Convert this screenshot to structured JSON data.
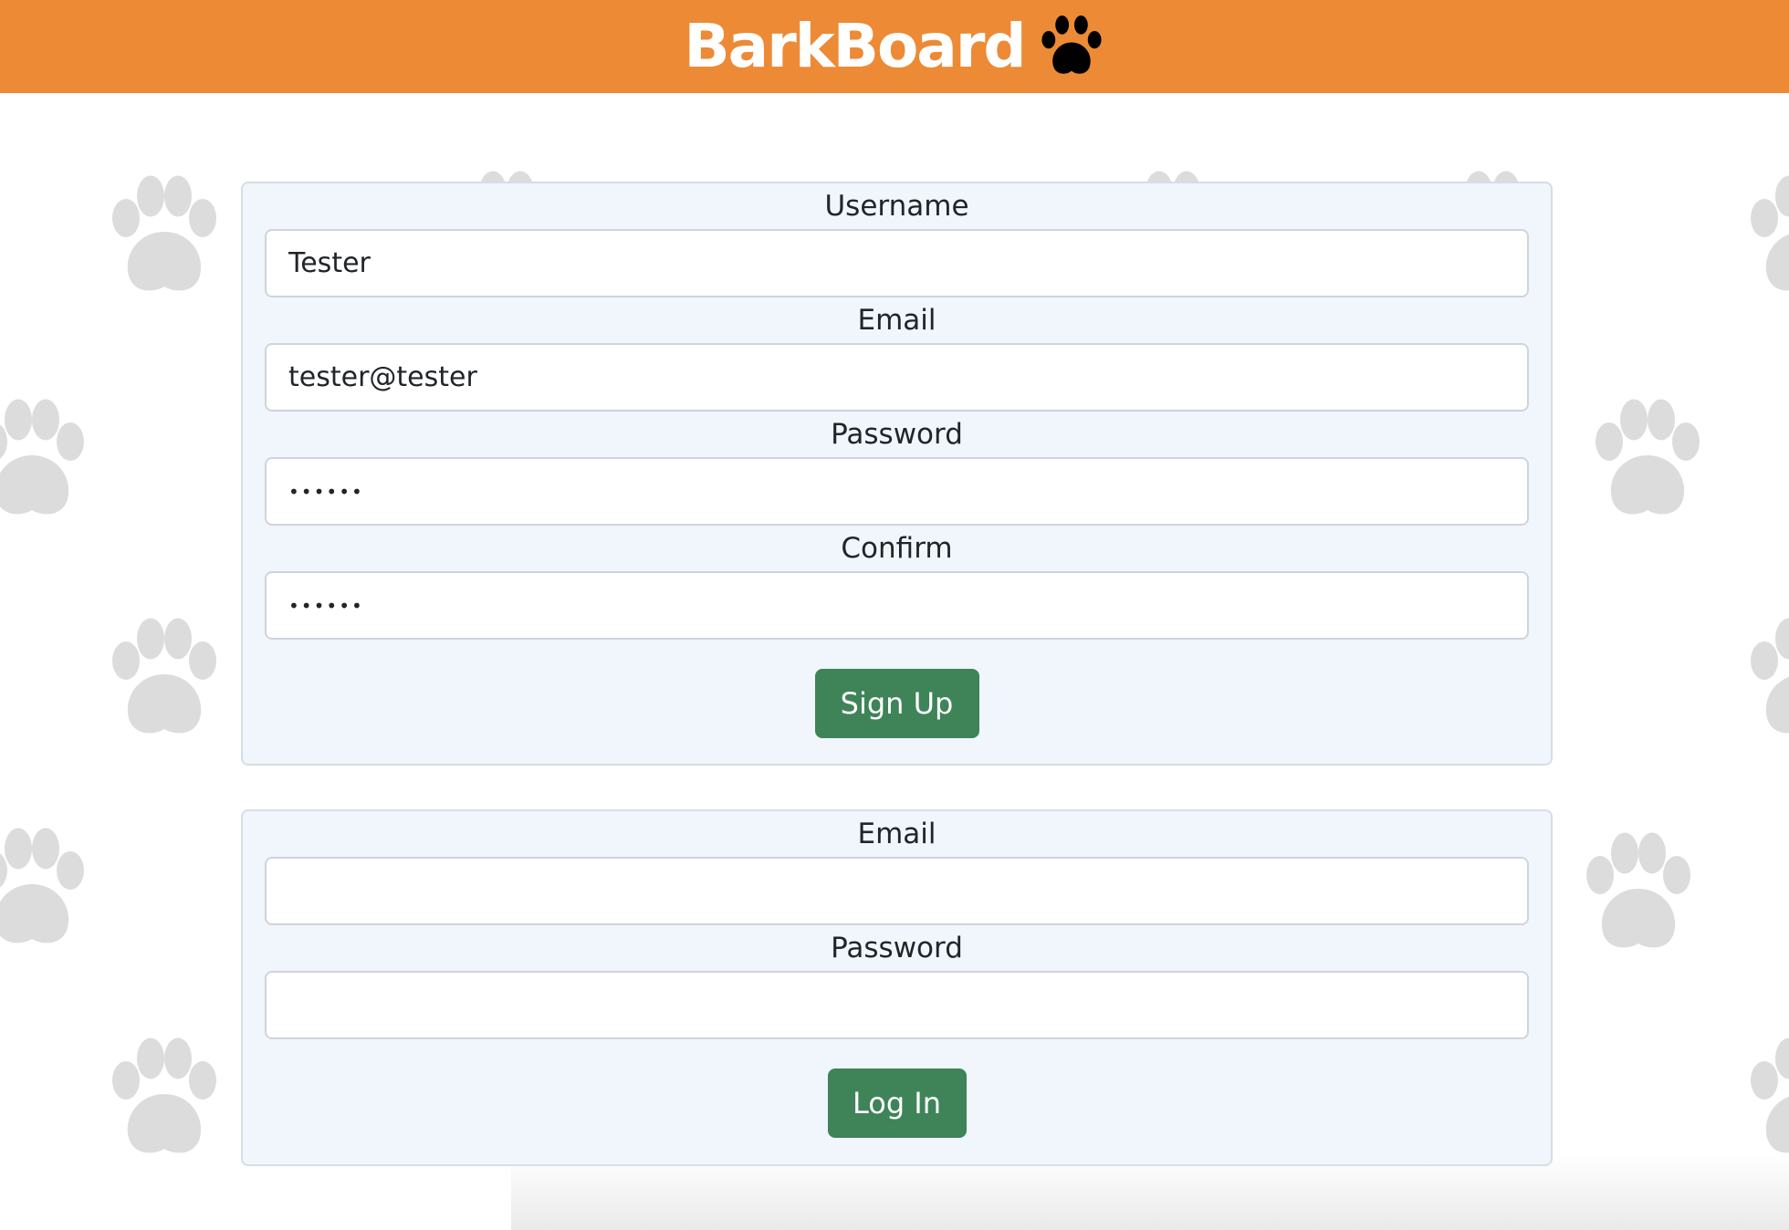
{
  "header": {
    "brand_name": "BarkBoard",
    "brand_icon": "paw-icon",
    "background_color": "#ED8A35"
  },
  "signup_form": {
    "username_label": "Username",
    "username_value": "Tester",
    "email_label": "Email",
    "email_value": "tester@tester",
    "password_label": "Password",
    "password_value": "••••••",
    "confirm_label": "Confirm",
    "confirm_value": "••••••",
    "submit_label": "Sign Up"
  },
  "login_form": {
    "email_label": "Email",
    "email_value": "",
    "password_label": "Password",
    "password_value": "",
    "submit_label": "Log In"
  },
  "colors": {
    "accent_orange": "#ED8A35",
    "button_green": "#3E8458",
    "card_background": "#F0F6FC",
    "paw_pattern": "#DCDCDC"
  }
}
